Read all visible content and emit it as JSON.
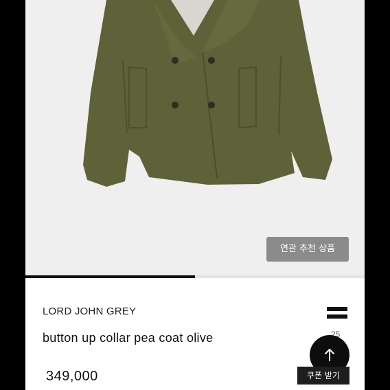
{
  "product": {
    "brand": "LORD JOHN GREY",
    "name": "button up collar pea coat olive",
    "price": "349,000"
  },
  "actions": {
    "related_label": "연관 추천 상품",
    "coupon_label": "쿠폰 받기",
    "share_count": "25"
  },
  "gallery": {
    "progress_percent": 50
  },
  "icons": {
    "share": "share-icon",
    "top": "arrow-up-icon"
  },
  "colors": {
    "coat": "#5f6138",
    "background": "#efefef",
    "dark": "#111111"
  }
}
